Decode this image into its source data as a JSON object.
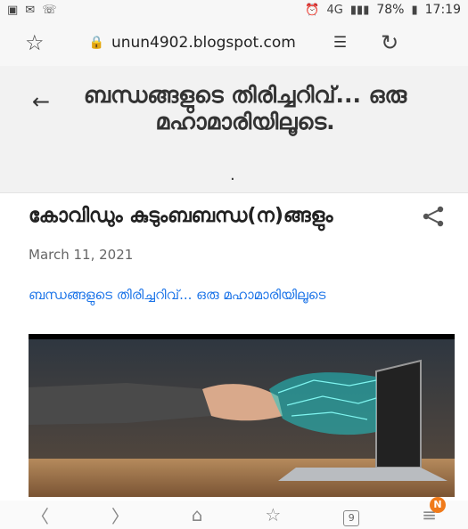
{
  "status_bar": {
    "signal_label": "4G",
    "battery": "78%",
    "time": "17:19"
  },
  "browser": {
    "url": "unun4902.blogspot.com"
  },
  "blog": {
    "title": "ബന്ധങ്ങളുടെ തിരിച്ചറിവ്... ഒരു മഹാമാരിയിലൂടെ.",
    "dot": "."
  },
  "post": {
    "title": "കോവിഡും കുടുംബബന്ധ(ന)ങ്ങളും",
    "date": "March 11, 2021",
    "link_text": "ബന്ധങ്ങളുടെ തിരിച്ചറിവ്... ഒരു മഹാമാരിയിലൂടെ"
  },
  "nav": {
    "tab_count": "9",
    "notification_badge": "N"
  },
  "colors": {
    "accent_link": "#1a73e8",
    "badge": "#f07a1a"
  }
}
